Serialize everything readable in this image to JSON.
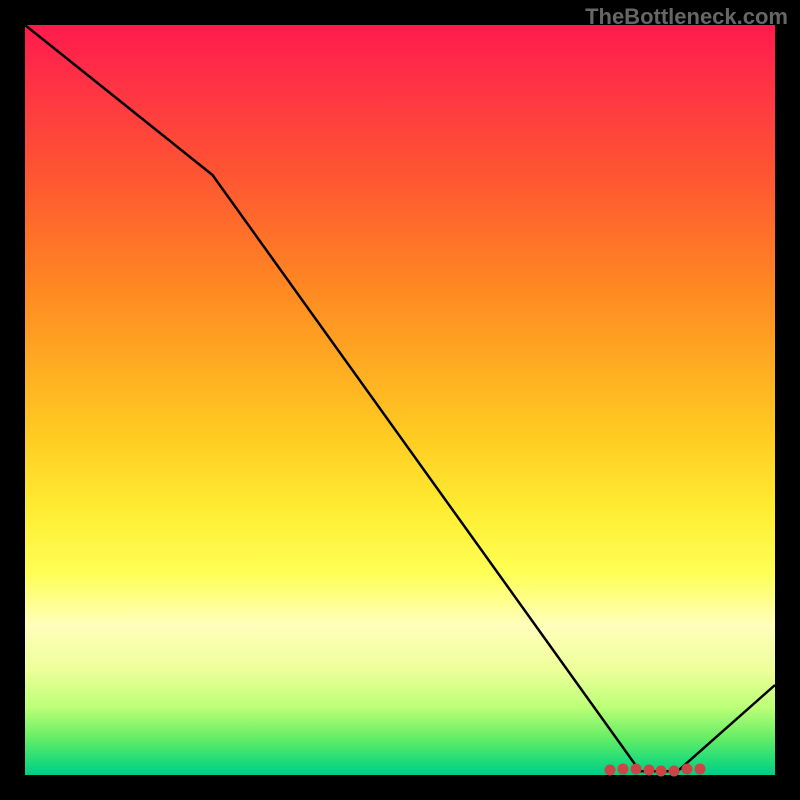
{
  "watermark": "TheBottleneck.com",
  "chart_data": {
    "type": "line",
    "x": [
      0,
      25,
      82,
      87,
      100
    ],
    "values": [
      100,
      80,
      0.5,
      0.5,
      12
    ],
    "xlabel": "",
    "ylabel": "",
    "xlim": [
      0,
      100
    ],
    "ylim": [
      0,
      100
    ],
    "title": "",
    "markers_segment": {
      "x_start": 78,
      "x_end": 90,
      "y": 0.7,
      "count": 8
    },
    "background": "rainbow-gradient-red-to-green",
    "grid": false
  }
}
